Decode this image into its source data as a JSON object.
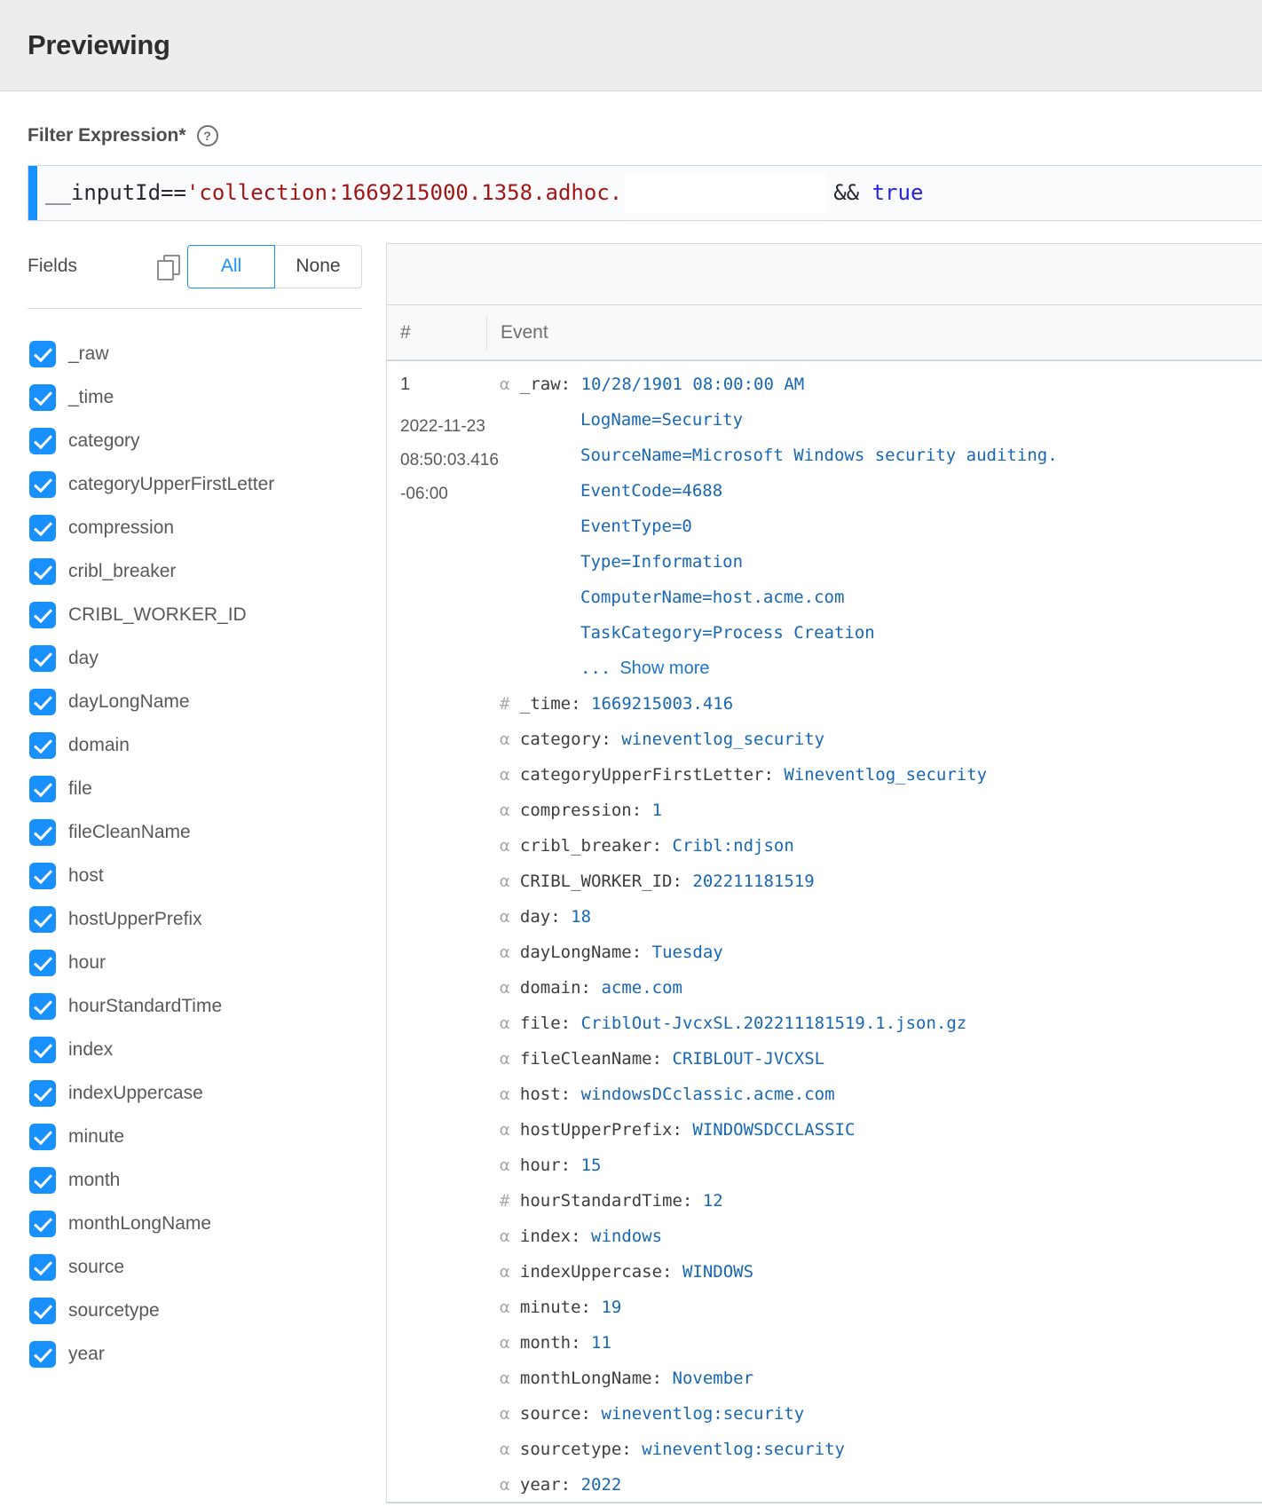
{
  "colors": {
    "accent_blue": "#1890ff",
    "value_blue": "#1767b8",
    "link_blue": "#1b74d0",
    "string_red": "#a31515",
    "keyword_blue": "#2424d8",
    "header_bar_gray": "#ededed"
  },
  "header": {
    "title": "Previewing"
  },
  "filter": {
    "label": "Filter Expression*",
    "help_icon": "question-circle",
    "expression": {
      "lhs": "__inputId==",
      "string_literal": "'collection:1669215000.1358.adhoc.",
      "operator": "&&",
      "keyword": "true"
    }
  },
  "fields_panel": {
    "title": "Fields",
    "copy_icon": "copy",
    "select_all_label": "All",
    "select_none_label": "None",
    "items": [
      {
        "label": "_raw",
        "checked": true
      },
      {
        "label": "_time",
        "checked": true
      },
      {
        "label": "category",
        "checked": true
      },
      {
        "label": "categoryUpperFirstLetter",
        "checked": true
      },
      {
        "label": "compression",
        "checked": true
      },
      {
        "label": "cribl_breaker",
        "checked": true
      },
      {
        "label": "CRIBL_WORKER_ID",
        "checked": true
      },
      {
        "label": "day",
        "checked": true
      },
      {
        "label": "dayLongName",
        "checked": true
      },
      {
        "label": "domain",
        "checked": true
      },
      {
        "label": "file",
        "checked": true
      },
      {
        "label": "fileCleanName",
        "checked": true
      },
      {
        "label": "host",
        "checked": true
      },
      {
        "label": "hostUpperPrefix",
        "checked": true
      },
      {
        "label": "hour",
        "checked": true
      },
      {
        "label": "hourStandardTime",
        "checked": true
      },
      {
        "label": "index",
        "checked": true
      },
      {
        "label": "indexUppercase",
        "checked": true
      },
      {
        "label": "minute",
        "checked": true
      },
      {
        "label": "month",
        "checked": true
      },
      {
        "label": "monthLongName",
        "checked": true
      },
      {
        "label": "source",
        "checked": true
      },
      {
        "label": "sourcetype",
        "checked": true
      },
      {
        "label": "year",
        "checked": true
      }
    ]
  },
  "events_table": {
    "columns": {
      "index": "#",
      "event": "Event"
    },
    "rows": [
      {
        "index": "1",
        "timestamp_lines": [
          "2022-11-23",
          "08:50:03.416",
          "-06:00"
        ],
        "fields": [
          {
            "type_glyph": "α",
            "key": "_raw",
            "value": "10/28/1901 08:00:00 AM",
            "extra_lines": [
              "LogName=Security",
              "SourceName=Microsoft Windows security auditing.",
              "EventCode=4688",
              "EventType=0",
              "Type=Information",
              "ComputerName=host.acme.com",
              "TaskCategory=Process Creation"
            ],
            "truncation": {
              "ellipsis": "...",
              "link_label": "Show more"
            }
          },
          {
            "type_glyph": "#",
            "key": "_time",
            "value": "1669215003.416"
          },
          {
            "type_glyph": "α",
            "key": "category",
            "value": "wineventlog_security"
          },
          {
            "type_glyph": "α",
            "key": "categoryUpperFirstLetter",
            "value": "Wineventlog_security"
          },
          {
            "type_glyph": "α",
            "key": "compression",
            "value": "1"
          },
          {
            "type_glyph": "α",
            "key": "cribl_breaker",
            "value": "Cribl:ndjson"
          },
          {
            "type_glyph": "α",
            "key": "CRIBL_WORKER_ID",
            "value": "202211181519"
          },
          {
            "type_glyph": "α",
            "key": "day",
            "value": "18"
          },
          {
            "type_glyph": "α",
            "key": "dayLongName",
            "value": "Tuesday"
          },
          {
            "type_glyph": "α",
            "key": "domain",
            "value": "acme.com"
          },
          {
            "type_glyph": "α",
            "key": "file",
            "value": "CriblOut-JvcxSL.202211181519.1.json.gz"
          },
          {
            "type_glyph": "α",
            "key": "fileCleanName",
            "value": "CRIBLOUT-JVCXSL"
          },
          {
            "type_glyph": "α",
            "key": "host",
            "value": "windowsDCclassic.acme.com"
          },
          {
            "type_glyph": "α",
            "key": "hostUpperPrefix",
            "value": "WINDOWSDCCLASSIC"
          },
          {
            "type_glyph": "α",
            "key": "hour",
            "value": "15"
          },
          {
            "type_glyph": "#",
            "key": "hourStandardTime",
            "value": "12"
          },
          {
            "type_glyph": "α",
            "key": "index",
            "value": "windows"
          },
          {
            "type_glyph": "α",
            "key": "indexUppercase",
            "value": "WINDOWS"
          },
          {
            "type_glyph": "α",
            "key": "minute",
            "value": "19"
          },
          {
            "type_glyph": "α",
            "key": "month",
            "value": "11"
          },
          {
            "type_glyph": "α",
            "key": "monthLongName",
            "value": "November"
          },
          {
            "type_glyph": "α",
            "key": "source",
            "value": "wineventlog:security"
          },
          {
            "type_glyph": "α",
            "key": "sourcetype",
            "value": "wineventlog:security"
          },
          {
            "type_glyph": "α",
            "key": "year",
            "value": "2022"
          }
        ]
      }
    ]
  }
}
